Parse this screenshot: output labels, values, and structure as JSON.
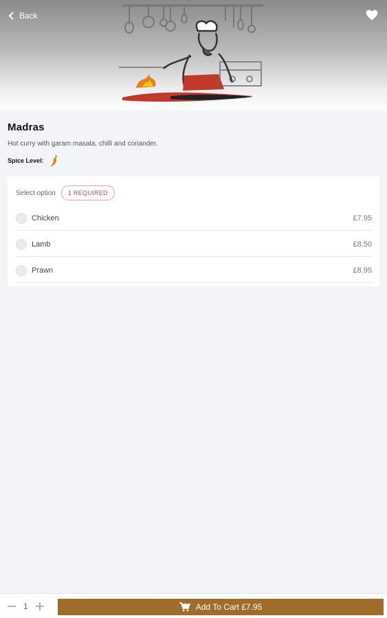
{
  "header": {
    "back_label": "Back"
  },
  "item": {
    "title": "Madras",
    "description": "Hot curry with garam masala, chilli and coriander.",
    "spice_label": "Spice Level:",
    "spice_level": 1
  },
  "options": {
    "label": "Select option",
    "required": "1 REQUIRED",
    "items": [
      {
        "name": "Chicken",
        "price": "£7.95"
      },
      {
        "name": "Lamb",
        "price": "£8.50"
      },
      {
        "name": "Prawn",
        "price": "£8.95"
      }
    ]
  },
  "footer": {
    "quantity": "1",
    "add_label": "Add To Cart £7.95"
  },
  "colors": {
    "accent": "#9e6d2a",
    "required": "#c4475b",
    "background": "#f2f4f7"
  }
}
